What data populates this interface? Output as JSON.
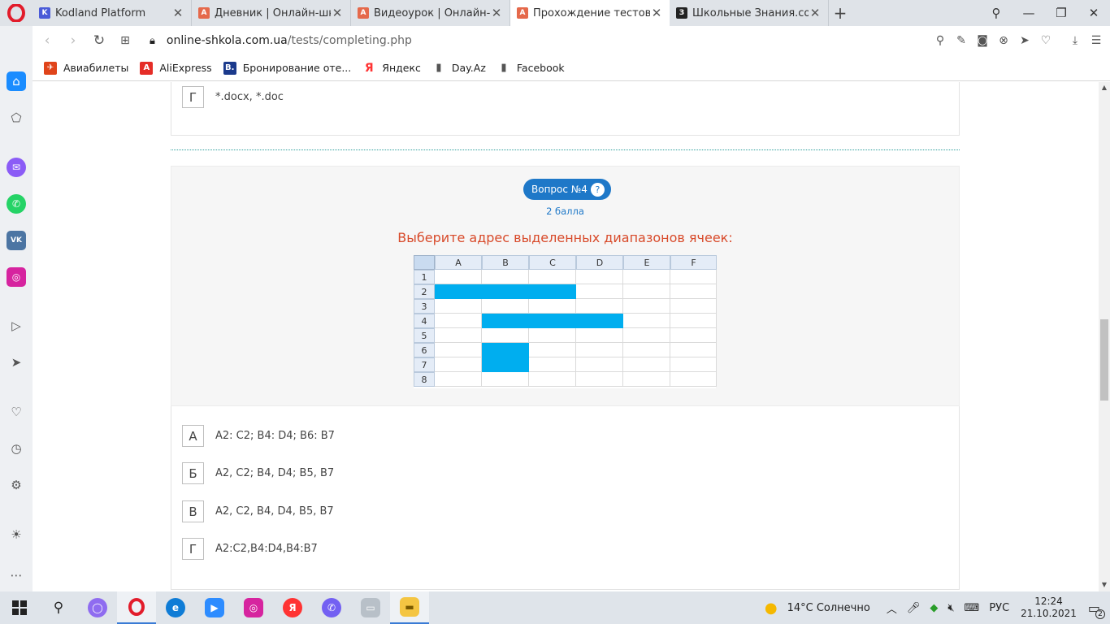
{
  "browser": {
    "tabs": [
      {
        "title": "Kodland Platform",
        "icon": "kodland-favicon",
        "color": "#4a5bd8",
        "glyph": "K"
      },
      {
        "title": "Дневник | Онлайн-школа",
        "icon": "school-favicon",
        "color": "#e5694b",
        "glyph": "A"
      },
      {
        "title": "Видеоурок | Онлайн-школа",
        "icon": "school-favicon",
        "color": "#e5694b",
        "glyph": "A"
      },
      {
        "title": "Прохождение тестового д",
        "icon": "school-favicon",
        "color": "#e5694b",
        "glyph": "A"
      },
      {
        "title": "Школьные Знания.com - Р",
        "icon": "znanija-favicon",
        "color": "#222222",
        "glyph": "З"
      }
    ],
    "url_host": "online-shkola.com.ua",
    "url_path": "/tests/completing.php",
    "bookmarks": [
      {
        "label": "Авиабилеты",
        "color": "#e0441a",
        "glyph": "✈"
      },
      {
        "label": "AliExpress",
        "color": "#e52d27",
        "glyph": "A"
      },
      {
        "label": "Бронирование оте...",
        "color": "#1b3a8c",
        "glyph": "B."
      },
      {
        "label": "Яндекс",
        "color": "#ff3333",
        "glyph": "Я"
      },
      {
        "label": "Day.Az",
        "color": "#555555",
        "glyph": "▮"
      },
      {
        "label": "Facebook",
        "color": "#555555",
        "glyph": "▮"
      }
    ]
  },
  "previous_question": {
    "last_option_letter": "Г",
    "last_option_text": "*.docx, *.doc"
  },
  "question": {
    "badge": "Вопрос №4",
    "help": "?",
    "points": "2 балла",
    "text": "Выберите адрес выделенных  диапазонов ячеек:",
    "sheet": {
      "columns": [
        "A",
        "B",
        "C",
        "D",
        "E",
        "F"
      ],
      "rows": [
        "1",
        "2",
        "3",
        "4",
        "5",
        "6",
        "7",
        "8"
      ],
      "highlight_color": "#00aeef",
      "highlighted_ranges": [
        "A2:C2",
        "B4:D4",
        "B6:B7"
      ]
    },
    "options": [
      {
        "letter": "А",
        "text": "A2: C2; B4: D4; B6: B7"
      },
      {
        "letter": "Б",
        "text": "A2, C2; B4, D4; B5, B7"
      },
      {
        "letter": "В",
        "text": "A2, C2, B4, D4, B5, B7"
      },
      {
        "letter": "Г",
        "text": "A2:C2,B4:D4,B4:B7"
      }
    ]
  },
  "taskbar": {
    "weather": "14°C  Солнечно",
    "lang": "РУС",
    "time": "12:24",
    "date": "21.10.2021",
    "notifications": "2"
  },
  "colors": {
    "accent": "#1e78c8",
    "question_text": "#d84a2a"
  }
}
